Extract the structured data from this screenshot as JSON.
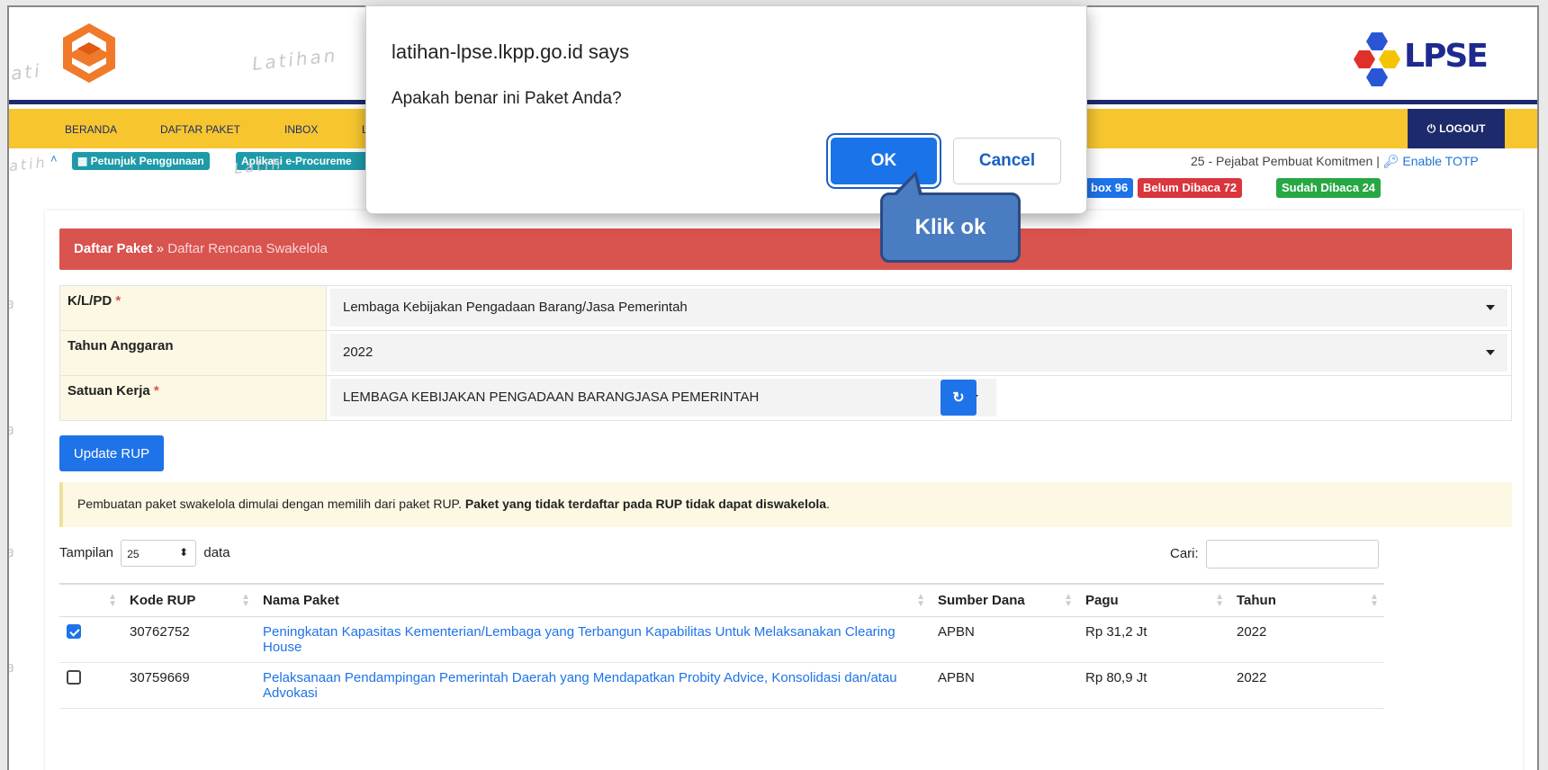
{
  "header": {
    "watermark": "Latihan",
    "brand_logo_text": "LPSE"
  },
  "nav": {
    "items": [
      "BERANDA",
      "DAFTAR PAKET",
      "INBOX",
      "L"
    ],
    "logout_label": "LOGOUT"
  },
  "subbar": {
    "help_label": "Petunjuk Penggunaan",
    "eproc_label": "Aplikasi e-Procureme",
    "role_text": "25 - Pejabat Pembuat Komitmen |",
    "totp_label": "Enable TOTP"
  },
  "badges": {
    "inbox": "box 96",
    "unread": "Belum Dibaca 72",
    "read": "Sudah Dibaca 24"
  },
  "panel": {
    "crumb_root": "Daftar Paket",
    "separator": "»",
    "crumb_current": "Daftar Rencana Swakelola"
  },
  "form": {
    "klpd_label": "K/L/PD",
    "klpd_value": "Lembaga Kebijakan Pengadaan Barang/Jasa Pemerintah",
    "tahun_label": "Tahun Anggaran",
    "tahun_value": "2022",
    "satker_label": "Satuan Kerja",
    "satker_value": "LEMBAGA KEBIJAKAN PENGADAAN BARANGJASA PEMERINTAH",
    "required_mark": "*"
  },
  "update_button": "Update RUP",
  "alert": {
    "text": "Pembuatan paket swakelola dimulai dengan memilih dari paket RUP. ",
    "bold": "Paket yang tidak terdaftar pada RUP tidak dapat diswakelola",
    "end": "."
  },
  "table_controls": {
    "show_label": "Tampilan",
    "page_size": "25",
    "data_label": "data",
    "search_label": "Cari:"
  },
  "table": {
    "headers": [
      "Kode RUP",
      "Nama Paket",
      "Sumber Dana",
      "Pagu",
      "Tahun"
    ],
    "rows": [
      {
        "checked": true,
        "kode": "30762752",
        "nama": "Peningkatan Kapasitas Kementerian/Lembaga yang Terbangun Kapabilitas Untuk Melaksanakan Clearing House",
        "sumber": "APBN",
        "pagu": "Rp 31,2 Jt",
        "tahun": "2022"
      },
      {
        "checked": false,
        "kode": "30759669",
        "nama": "Pelaksanaan Pendampingan Pemerintah Daerah yang Mendapatkan Probity Advice, Konsolidasi dan/atau Advokasi",
        "sumber": "APBN",
        "pagu": "Rp 80,9 Jt",
        "tahun": "2022"
      }
    ]
  },
  "dialog": {
    "title": "latihan-lpse.lkpp.go.id says",
    "message": "Apakah benar ini Paket Anda?",
    "ok_label": "OK",
    "cancel_label": "Cancel"
  },
  "callout": {
    "text": "Klik ok"
  },
  "colors": {
    "navbar": "#f7c62f",
    "navy": "#1d2a6b",
    "panel_red": "#d9534f",
    "primary_blue": "#1e73e8"
  }
}
